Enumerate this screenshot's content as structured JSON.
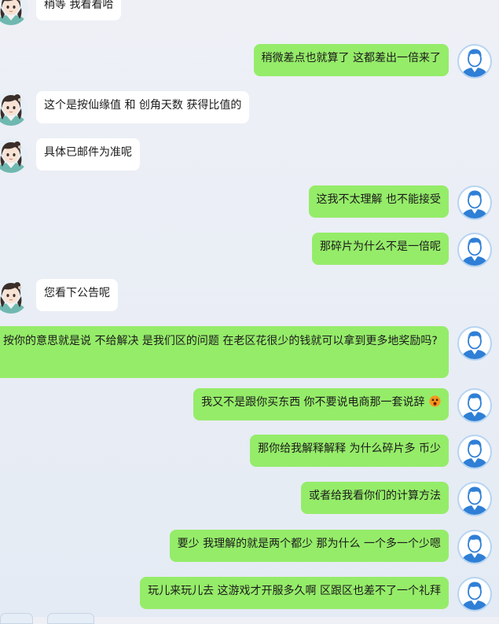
{
  "messages": [
    {
      "side": "in",
      "text": "稍等 我看看哈"
    },
    {
      "side": "out",
      "text": "稍微差点也就算了 这都差出一倍来了"
    },
    {
      "side": "in",
      "text": "这个是按仙缘值 和 创角天数 获得比值的"
    },
    {
      "side": "in",
      "text": "具体已邮件为准呢"
    },
    {
      "side": "out",
      "text": "这我不太理解 也不能接受"
    },
    {
      "side": "out",
      "text": "那碎片为什么不是一倍呢"
    },
    {
      "side": "in",
      "text": "您看下公告呢"
    },
    {
      "side": "out",
      "text": "按你的意思就是说 不给解决 是我们区的问题 在老区花很少的钱就可以拿到更多地奖励吗?"
    },
    {
      "side": "out",
      "text": "我又不是跟你买东西 你不要说电商那一套说辞",
      "emoji": "dizzy-face-emoji"
    },
    {
      "side": "out",
      "text": "那你给我解释解释 为什么碎片多 币少"
    },
    {
      "side": "out",
      "text": "或者给我看你们的计算方法"
    },
    {
      "side": "out",
      "text": "要少 我理解的就是两个都少 那为什么 一个多一个少嗯"
    },
    {
      "side": "out",
      "text": "玩儿来玩儿去 这游戏才开服多久啊 区跟区也差不了一个礼拜"
    }
  ],
  "colors": {
    "incoming_bubble": "#ffffff",
    "outgoing_bubble": "#95ec69",
    "user_avatar": "#2f7fd6"
  },
  "icons": {
    "agent_avatar": "anime-girl-avatar-icon",
    "user_avatar": "user-silhouette-avatar-icon"
  }
}
